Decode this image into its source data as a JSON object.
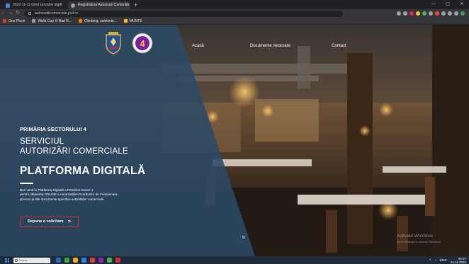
{
  "browser": {
    "tabs": [
      {
        "title": "2022-11-11 Ghid serviciile digit",
        "icon": "document-favicon-icon",
        "color": "#4f86d6",
        "active": false
      },
      {
        "title": "Registratura Autorizari Comercia",
        "icon": "site-favicon-icon",
        "color": "#e8eaed",
        "active": true
      }
    ],
    "url": "autorizatiicomerciale.ps4.ro",
    "bookmarks": [
      {
        "label": "One Piece",
        "color": "#e53935"
      },
      {
        "label": "Walls Cup Yi Bad R...",
        "color": "#9aa0a6"
      },
      {
        "label": "Climbing, swimmin...",
        "color": "#f57c00"
      },
      {
        "label": "MUNTE",
        "color": "#fbc02d"
      }
    ],
    "extension_colors": [
      "#9aa0a6",
      "#9aa0a6",
      "#e91e63",
      "#fbc02d",
      "#4caf50",
      "#9aa0a6",
      "#f44336",
      "#9aa0a6",
      "#9aa0a6",
      "#9aa0a6",
      "#43a047"
    ]
  },
  "nav": {
    "links": [
      "Acasă",
      "Documente necesare",
      "Contact"
    ]
  },
  "hero": {
    "subtitle": "PRIMĂRIA SECTORULUI 4",
    "title_line1": "SERVICIUL",
    "title_line2": "AUTORIZĂRI COMERCIALE",
    "main_title": "PLATFORMA DIGITALĂ",
    "description_line1": "Bun venit în Platforma Digitală a Primăriei Sector 4",
    "description_line2": "pentru obținerea ONLINE a Autorizațiilor/Acordurilor de Funcționare,",
    "description_line3": "precum și alte documente specifice activităților comerciale.",
    "cta_label": "Depune o solicitare",
    "cta_arrow": ">",
    "scroll_glyph": "»"
  },
  "watermark": {
    "line1": "Activate Windows",
    "line2": "Go to Settings to activate Windows."
  },
  "taskbar": {
    "search_placeholder": "Search",
    "app_colors": [
      "#2b6cb0",
      "#43a047",
      "#f9a825",
      "#1e88e5",
      "#e53935",
      "#8e24aa",
      "#4caf50",
      "#d32f2f"
    ],
    "lang": "ENG",
    "time": "00:27",
    "date": "14.11.2022"
  },
  "colors": {
    "overlay": "#2b4a66",
    "cta_border": "#d32f2f"
  }
}
